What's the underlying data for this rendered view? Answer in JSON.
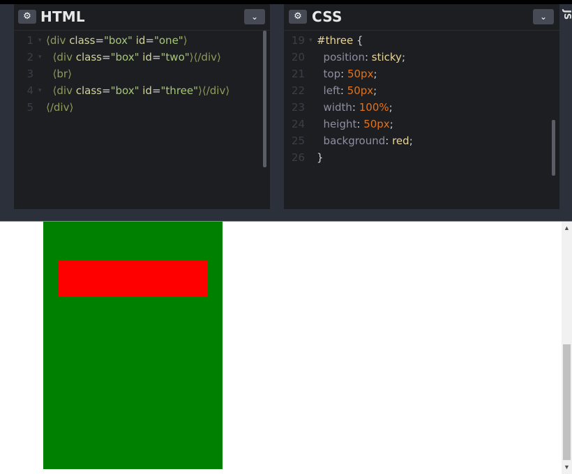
{
  "html_panel": {
    "title": "HTML",
    "settings_icon": "gear-icon",
    "collapse_icon": "chevron-down-icon",
    "lines": [
      {
        "num": "1",
        "fold": "▾",
        "indent": "",
        "tokens": [
          {
            "t": "tag",
            "v": "⟨div "
          },
          {
            "t": "attr",
            "v": "class"
          },
          {
            "t": "pun",
            "v": "="
          },
          {
            "t": "str",
            "v": "\"box\" "
          },
          {
            "t": "attr",
            "v": "id"
          },
          {
            "t": "pun",
            "v": "="
          },
          {
            "t": "str",
            "v": "\"one\""
          },
          {
            "t": "tag",
            "v": "⟩"
          }
        ]
      },
      {
        "num": "2",
        "fold": "▾",
        "indent": "  ",
        "tokens": [
          {
            "t": "tag",
            "v": "⟨div "
          },
          {
            "t": "attr",
            "v": "class"
          },
          {
            "t": "pun",
            "v": "="
          },
          {
            "t": "str",
            "v": "\"box\" "
          },
          {
            "t": "attr",
            "v": "id"
          },
          {
            "t": "pun",
            "v": "="
          },
          {
            "t": "str",
            "v": "\"two\""
          },
          {
            "t": "tag",
            "v": "⟩⟨/div⟩"
          }
        ]
      },
      {
        "num": "3",
        "fold": "",
        "indent": "  ",
        "tokens": [
          {
            "t": "tag",
            "v": "⟨br⟩"
          }
        ]
      },
      {
        "num": "4",
        "fold": "▾",
        "indent": "  ",
        "tokens": [
          {
            "t": "tag",
            "v": "⟨div "
          },
          {
            "t": "attr",
            "v": "class"
          },
          {
            "t": "pun",
            "v": "="
          },
          {
            "t": "str",
            "v": "\"box\" "
          },
          {
            "t": "attr",
            "v": "id"
          },
          {
            "t": "pun",
            "v": "="
          },
          {
            "t": "str",
            "v": "\"three\""
          },
          {
            "t": "tag",
            "v": "⟩⟨/div⟩"
          }
        ]
      },
      {
        "num": "5",
        "fold": "",
        "indent": "",
        "tokens": [
          {
            "t": "tag",
            "v": "⟨/div⟩"
          }
        ]
      }
    ]
  },
  "css_panel": {
    "title": "CSS",
    "settings_icon": "gear-icon",
    "collapse_icon": "chevron-down-icon",
    "lines": [
      {
        "num": "19",
        "fold": "▾",
        "indent": "",
        "tokens": [
          {
            "t": "sel",
            "v": "#three "
          },
          {
            "t": "pun",
            "v": "{"
          }
        ]
      },
      {
        "num": "20",
        "fold": "",
        "indent": "  ",
        "tokens": [
          {
            "t": "prop",
            "v": "position"
          },
          {
            "t": "pun",
            "v": ": "
          },
          {
            "t": "val",
            "v": "sticky"
          },
          {
            "t": "pun",
            "v": ";"
          }
        ]
      },
      {
        "num": "21",
        "fold": "",
        "indent": "  ",
        "tokens": [
          {
            "t": "prop",
            "v": "top"
          },
          {
            "t": "pun",
            "v": ": "
          },
          {
            "t": "num",
            "v": "50px"
          },
          {
            "t": "pun",
            "v": ";"
          }
        ]
      },
      {
        "num": "22",
        "fold": "",
        "indent": "  ",
        "tokens": [
          {
            "t": "prop",
            "v": "left"
          },
          {
            "t": "pun",
            "v": ": "
          },
          {
            "t": "num",
            "v": "50px"
          },
          {
            "t": "pun",
            "v": ";"
          }
        ]
      },
      {
        "num": "23",
        "fold": "",
        "indent": "  ",
        "tokens": [
          {
            "t": "prop",
            "v": "width"
          },
          {
            "t": "pun",
            "v": ": "
          },
          {
            "t": "num",
            "v": "100%"
          },
          {
            "t": "pun",
            "v": ";"
          }
        ]
      },
      {
        "num": "24",
        "fold": "",
        "indent": "  ",
        "tokens": [
          {
            "t": "prop",
            "v": "height"
          },
          {
            "t": "pun",
            "v": ": "
          },
          {
            "t": "num",
            "v": "50px"
          },
          {
            "t": "pun",
            "v": ";"
          }
        ]
      },
      {
        "num": "25",
        "fold": "",
        "indent": "  ",
        "tokens": [
          {
            "t": "prop",
            "v": "background"
          },
          {
            "t": "pun",
            "v": ": "
          },
          {
            "t": "val",
            "v": "red"
          },
          {
            "t": "pun",
            "v": ";"
          }
        ]
      },
      {
        "num": "26",
        "fold": "",
        "indent": "",
        "tokens": [
          {
            "t": "pun",
            "v": "}"
          }
        ]
      }
    ]
  },
  "js_panel": {
    "title": "JS"
  },
  "result": {
    "box_one_color": "#008000",
    "box_three_color": "#ff0000"
  },
  "colors": {
    "editor_bg": "#1d1e22",
    "chrome_bg": "#2c303a",
    "button_bg": "#454a55"
  }
}
